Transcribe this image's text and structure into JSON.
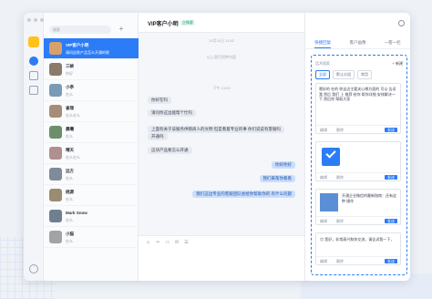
{
  "conversations": [
    {
      "name": "VIP客户小明",
      "msg": "请问这款产品怎么开通的呢",
      "active": true
    },
    {
      "name": "三峡",
      "msg": "你好",
      "active": false
    },
    {
      "name": "小亭",
      "msg": "在么",
      "active": false
    },
    {
      "name": "查理",
      "msg": "在么在么",
      "active": false
    },
    {
      "name": "晨曦",
      "msg": "在么",
      "active": false
    },
    {
      "name": "晴天",
      "msg": "在么在么",
      "active": false
    },
    {
      "name": "远方",
      "msg": "在么",
      "active": false
    },
    {
      "name": "桃源",
      "msg": "在么",
      "active": false
    },
    {
      "name": "Mark Snow",
      "msg": "在么",
      "active": false
    },
    {
      "name": "小猫",
      "msg": "在么",
      "active": false
    }
  ],
  "list": {
    "search_placeholder": "搜索"
  },
  "chat": {
    "title": "VIP客户小明",
    "tag": "企微客",
    "sys1": "10月31日 11:52",
    "sys2": "以上是打招呼内容",
    "sys3": "下午 13:00",
    "msg_hello": "你好在吗",
    "msg_ask": "请问你这边能帮个忙吗",
    "msg_detail1": "上面有关于该服务供销商人的文明 但是看着专业的事 你们说说有客服吗",
    "msg_detail2": "开通吗",
    "msg_how": "这块产品要怎么开通",
    "reply_hi": "你好你好",
    "reply_wait": "我们来帮你看看",
    "reply_long": "我们这边专业的客服团队会给你帮助你的 有什么问题",
    "tools": [
      "☺",
      "✂",
      "▭",
      "✉",
      "☰"
    ]
  },
  "panel": {
    "tabs": [
      "快捷回复",
      "客户画像",
      "一客一栏"
    ],
    "active_tab": 0,
    "search_placeholder": "话术搜索",
    "new_label": "+ 新建",
    "segments": [
      "全部",
      "默认分组",
      "常用"
    ],
    "card1_text": "嗯好的 在的 你这边主要关心哪方面的 可以 告诉我 然后 我们 上 推荐 给你 帮你详细 安排解决一下 然后你 帮助大家",
    "card3_title": "开通企业微信的最新指南：还有这种 操作",
    "card4_text": "😊 您好，非常高兴和你交流，请告诉我一下，",
    "edit_label": "编辑",
    "delete_label": "删除",
    "send_label": "发送"
  }
}
